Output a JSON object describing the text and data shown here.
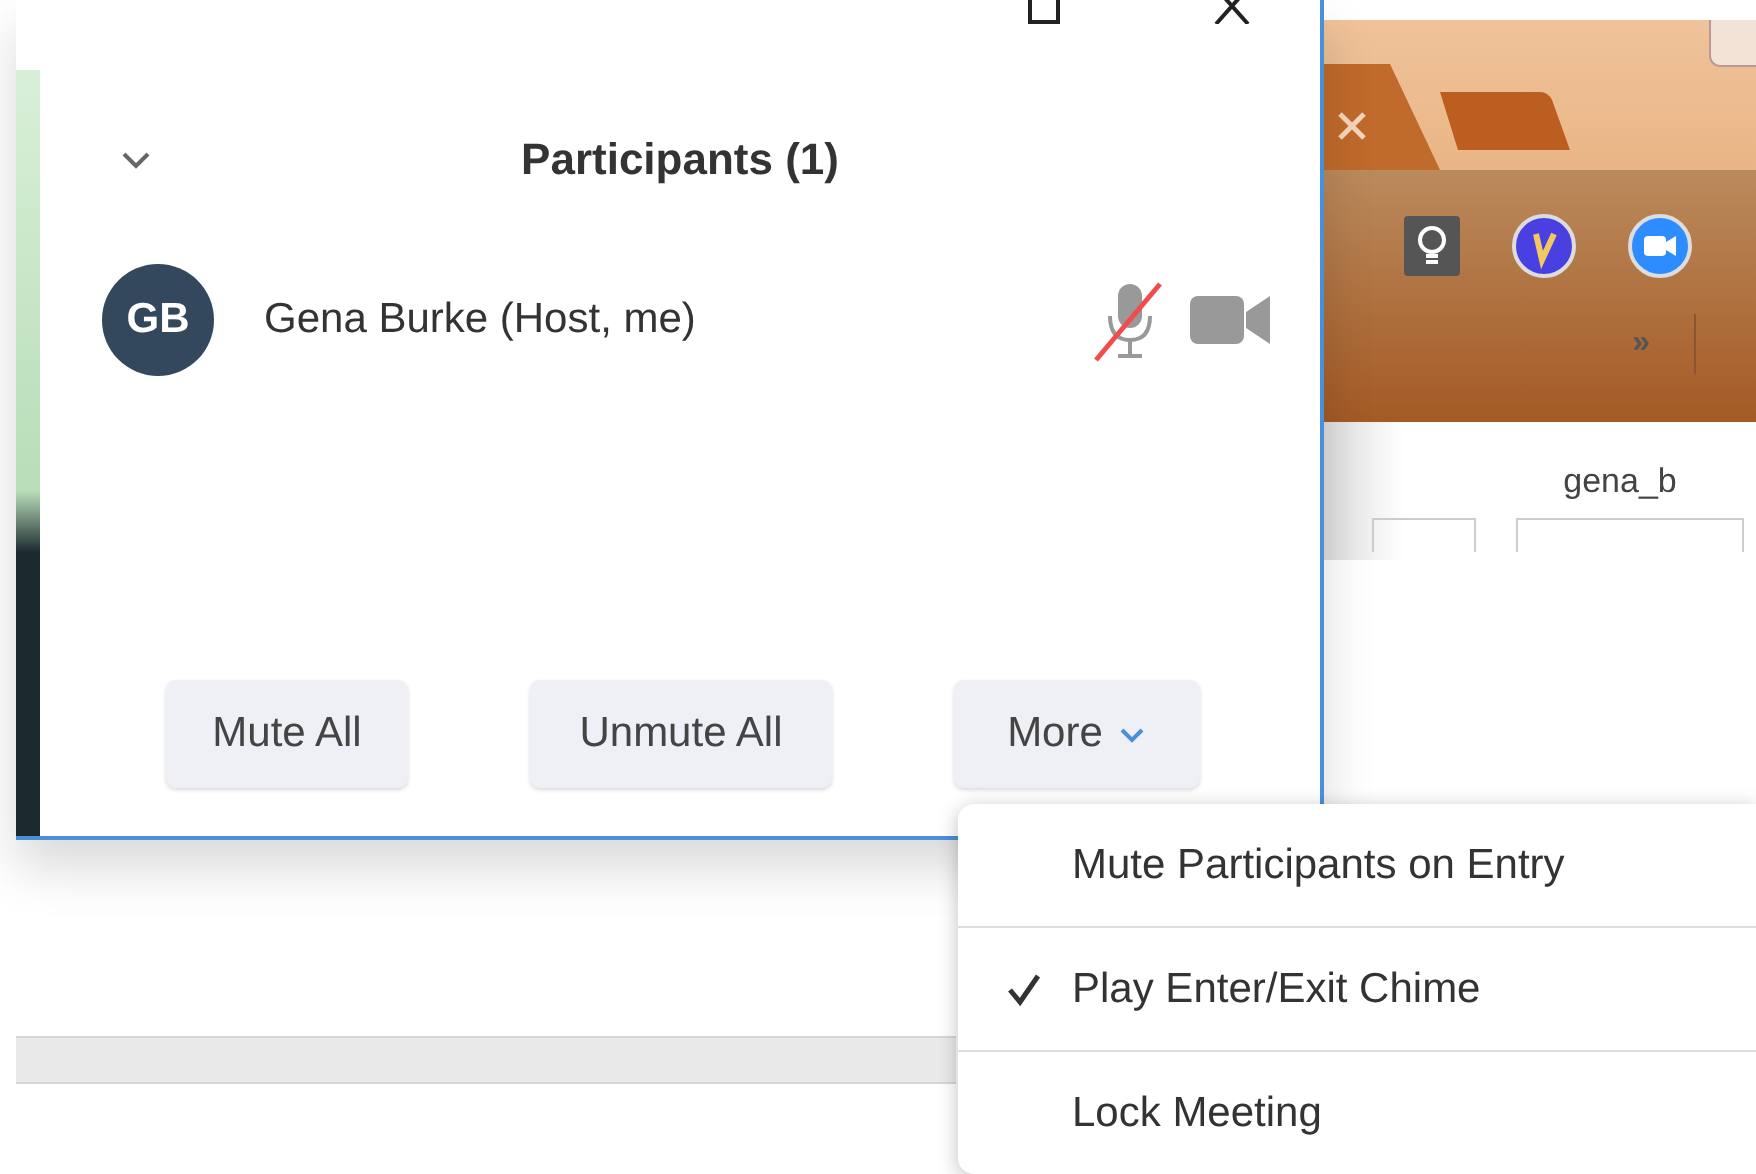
{
  "participants_window": {
    "title": "Participants (1)",
    "participants": [
      {
        "initials": "GB",
        "name": "Gena Burke (Host, me)",
        "muted": true
      }
    ],
    "buttons": [
      {
        "label": "Mute All",
        "kind": "plain"
      },
      {
        "label": "Unmute All",
        "kind": "plain"
      },
      {
        "label": "More",
        "kind": "dropdown"
      }
    ]
  },
  "background_browser": {
    "overflow": "»",
    "page_text": "gena_b"
  },
  "more_menu": {
    "items": [
      {
        "label": "Mute Participants on Entry",
        "checked": false
      },
      {
        "label": "Play Enter/Exit Chime",
        "checked": true
      },
      {
        "label": "Lock Meeting",
        "checked": false
      }
    ]
  }
}
